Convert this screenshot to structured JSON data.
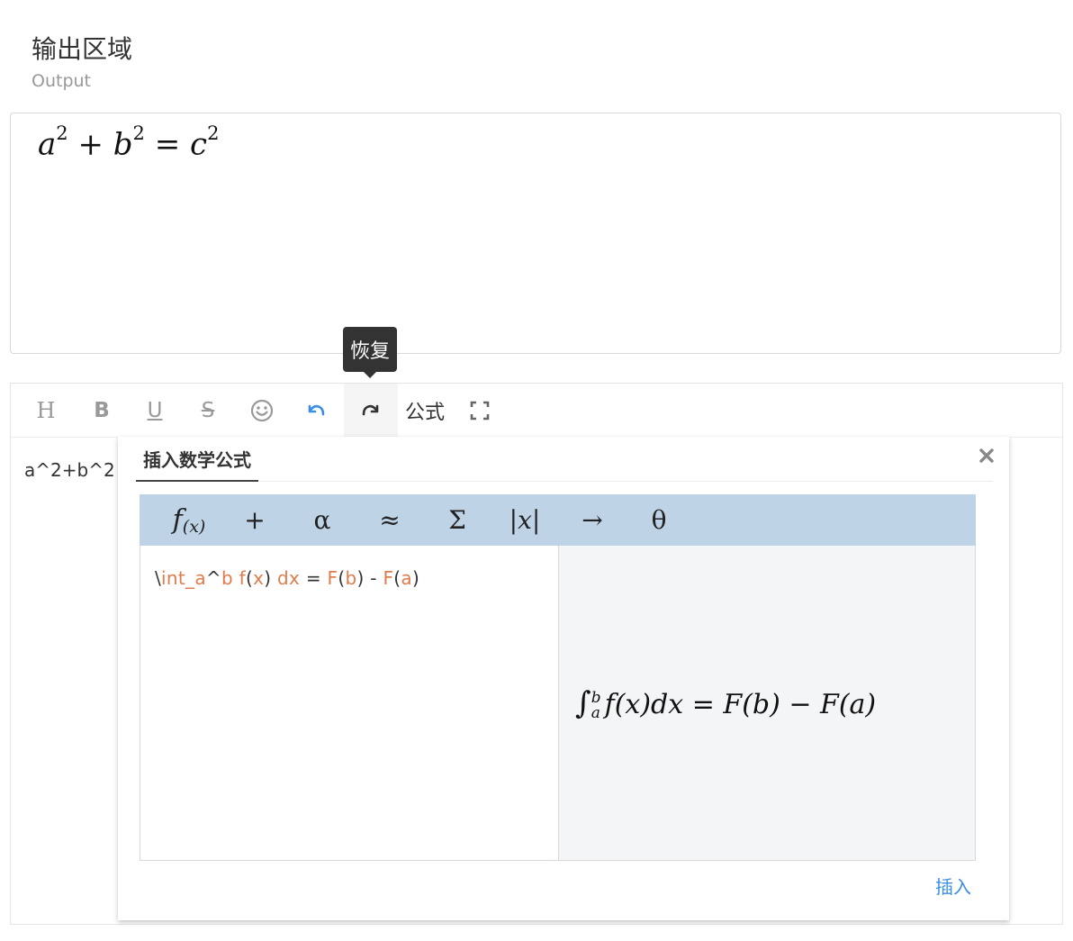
{
  "header": {
    "title": "输出区域",
    "subtitle": "Output"
  },
  "output": {
    "formula_a": "a",
    "formula_b": "b",
    "formula_c": "c",
    "exp": "2",
    "plus": "+",
    "eq": "="
  },
  "tooltip": {
    "text": "恢复"
  },
  "toolbar": {
    "heading_label": "H",
    "bold_label": "B",
    "underline_label": "U",
    "strike_label": "S",
    "emoji_icon": "smiley-icon",
    "undo_icon": "undo-icon",
    "redo_icon": "redo-icon",
    "formula_label": "公式",
    "fullscreen_icon": "fullscreen-icon",
    "undo_color": "#3a8ee6"
  },
  "editor": {
    "text": "a^2+b^2"
  },
  "dialog": {
    "tab_label": "插入数学公式",
    "close_icon": "close-icon",
    "mathbar": {
      "f": "f",
      "fx": "(x)",
      "plus": "+",
      "alpha": "α",
      "approx": "≈",
      "sigma": "Σ",
      "abs_bar1": "|",
      "abs_x": "x",
      "abs_bar2": "|",
      "arrow": "→",
      "theta": "θ"
    },
    "code": {
      "backslash": "\\",
      "int": "int_a",
      "caret": "^",
      "b1": "b",
      "f1": "f",
      "p1": "(",
      "x1": "x",
      "p2": ")",
      "dx": "dx",
      "eq": "=",
      "F1": "F",
      "p3": "(",
      "b2": "b",
      "p4": ")",
      "minus": "-",
      "F2": "F",
      "p5": "(",
      "a2": "a",
      "p6": ")"
    },
    "preview": {
      "int_sign": "∫",
      "upper": "b",
      "lower": "a",
      "body": "f(x)dx = F(b) − F(a)"
    },
    "insert_label": "插入",
    "accent_color": "#bed3e6"
  }
}
